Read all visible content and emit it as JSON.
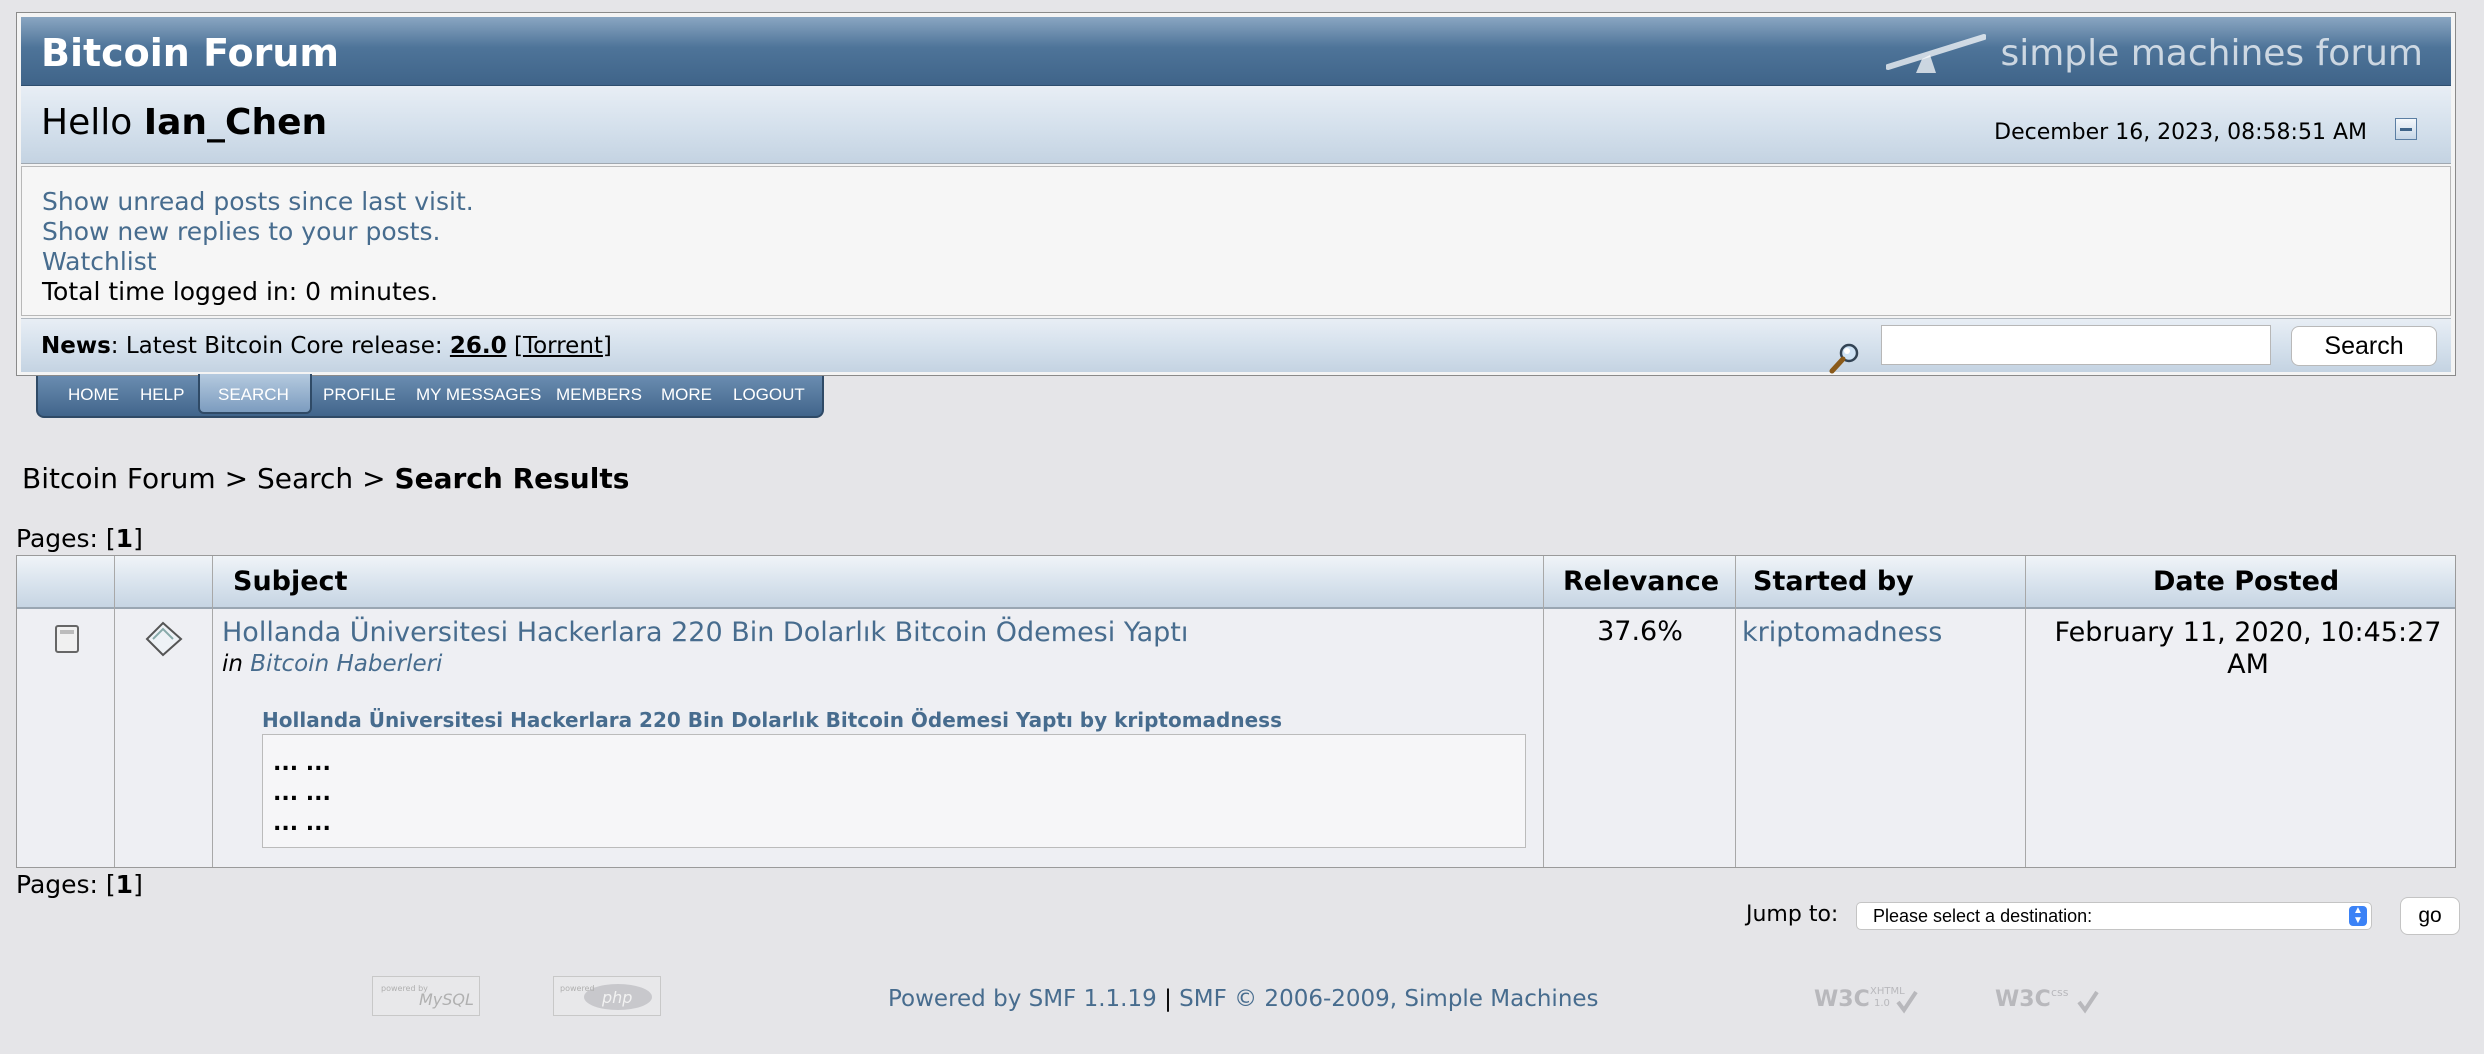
{
  "header": {
    "forum_title": "Bitcoin Forum",
    "logo_text": "simple machines forum",
    "hello_prefix": "Hello",
    "username": "Ian_Chen",
    "datetime": "December 16, 2023, 08:58:51 AM"
  },
  "user_panel": {
    "unread_link": "Show unread posts since last visit.",
    "replies_link": "Show new replies to your posts.",
    "watchlist_link": "Watchlist",
    "time_logged": "Total time logged in: 0 minutes."
  },
  "news": {
    "label": "News",
    "text": ": Latest Bitcoin Core release: ",
    "version": "26.0",
    "bracket_open": " [",
    "torrent": "Torrent",
    "bracket_close": "]"
  },
  "search": {
    "button_label": "Search",
    "value": ""
  },
  "tabs": [
    "HOME",
    "HELP",
    "SEARCH",
    "PROFILE",
    "MY MESSAGES",
    "MEMBERS",
    "MORE",
    "LOGOUT"
  ],
  "breadcrumb": {
    "root": "Bitcoin Forum",
    "sep": " > ",
    "search": "Search",
    "current": "Search Results"
  },
  "pages": {
    "label": "Pages: [",
    "current": "1",
    "close": "]"
  },
  "table": {
    "headers": {
      "subject": "Subject",
      "relevance": "Relevance",
      "started_by": "Started by",
      "date_posted": "Date Posted"
    },
    "row": {
      "title": "Hollanda Üniversitesi Hackerlara 220 Bin Dolarlık Bitcoin Ödemesi Yaptı",
      "in_label": "in",
      "board": "Bitcoin Haberleri",
      "preview_title": "Hollanda Üniversitesi Hackerlara 220 Bin Dolarlık Bitcoin Ödemesi Yaptı by kriptomadness",
      "preview_lines": [
        "...  ...",
        "...  ...",
        "...  ..."
      ],
      "relevance": "37.6%",
      "started_by": "kriptomadness",
      "date_line1": "February 11, 2020, 10:45:27",
      "date_line2": "AM"
    }
  },
  "jump": {
    "label": "Jump to:",
    "selected": "Please select a destination:",
    "go": "go"
  },
  "footer": {
    "powered": "Powered by SMF 1.1.19",
    "sep": " | ",
    "copyright": "SMF © 2006-2009, Simple Machines"
  },
  "colors": {
    "link": "#476c8e",
    "header_blue": "#4e7499",
    "page_bg": "#e5e5e8"
  },
  "icons": [
    "search-magnifier-icon",
    "collapse-icon",
    "post-icon",
    "topic-icon",
    "mysql-badge",
    "php-badge",
    "xhtml-badge",
    "css-badge"
  ]
}
